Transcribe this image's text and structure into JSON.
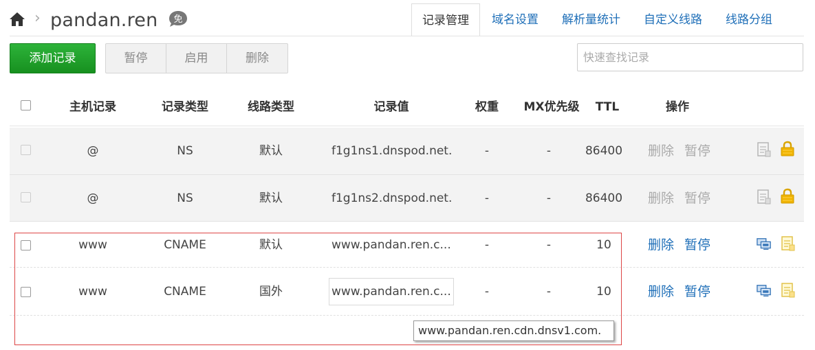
{
  "header": {
    "domain": "pandan.ren",
    "breadcrumb_sep": "›",
    "badge_text": "免",
    "tabs": [
      {
        "label": "记录管理"
      },
      {
        "label": "域名设置"
      },
      {
        "label": "解析量统计"
      },
      {
        "label": "自定义线路"
      },
      {
        "label": "线路分组"
      }
    ]
  },
  "toolbar": {
    "add_label": "添加记录",
    "pause_label": "暂停",
    "enable_label": "启用",
    "delete_label": "删除",
    "search_placeholder": "快速查找记录"
  },
  "table": {
    "columns": {
      "host": "主机记录",
      "type": "记录类型",
      "line": "线路类型",
      "value": "记录值",
      "weight": "权重",
      "mx": "MX优先级",
      "ttl": "TTL",
      "ops": "操作"
    },
    "rows": [
      {
        "host": "@",
        "type": "NS",
        "line": "默认",
        "value": "f1g1ns1.dnspod.net.",
        "weight": "-",
        "mx": "-",
        "ttl": "86400",
        "del": "删除",
        "pause": "暂停",
        "locked": true
      },
      {
        "host": "@",
        "type": "NS",
        "line": "默认",
        "value": "f1g1ns2.dnspod.net.",
        "weight": "-",
        "mx": "-",
        "ttl": "86400",
        "del": "删除",
        "pause": "暂停",
        "locked": true
      },
      {
        "host": "www",
        "type": "CNAME",
        "line": "默认",
        "value": "www.pandan.ren.c...",
        "weight": "-",
        "mx": "-",
        "ttl": "10",
        "del": "删除",
        "pause": "暂停",
        "locked": false
      },
      {
        "host": "www",
        "type": "CNAME",
        "line": "国外",
        "value": "www.pandan.ren.c...",
        "weight": "-",
        "mx": "-",
        "ttl": "10",
        "del": "删除",
        "pause": "暂停",
        "locked": false
      }
    ]
  },
  "tooltip": {
    "text": "www.pandan.ren.cdn.dnsv1.com."
  },
  "colors": {
    "accent": "#1f6fb8",
    "add_button": "#1e9e2a",
    "highlight": "#dd4444"
  },
  "icons": [
    "home-icon",
    "free-badge-icon",
    "note-icon",
    "lock-icon",
    "monitor-icon"
  ]
}
